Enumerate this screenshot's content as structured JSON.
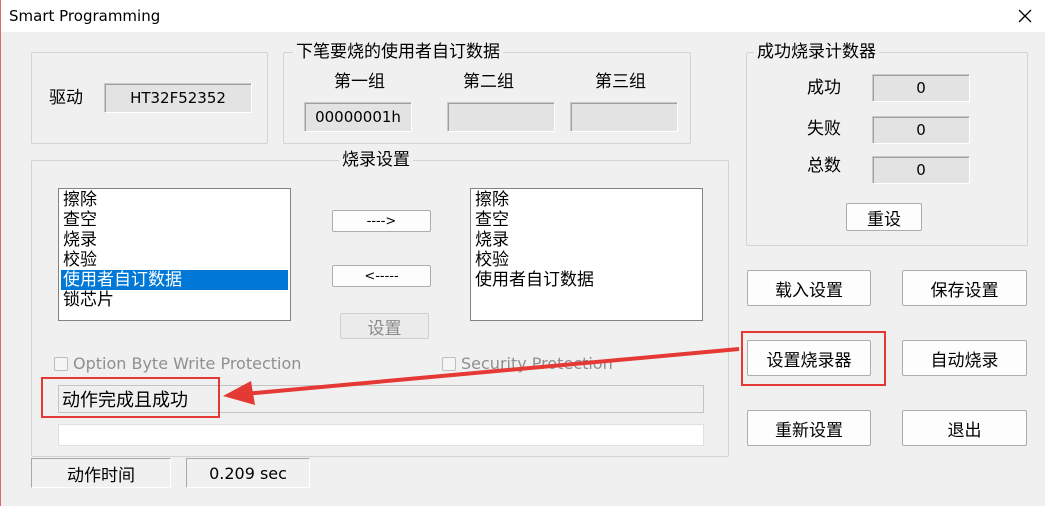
{
  "window": {
    "title": "Smart Programming"
  },
  "driver": {
    "label": "驱动",
    "value": "HT32F52352"
  },
  "user_data": {
    "legend": "下笔要烧的使用者自订数据",
    "groups": [
      {
        "label": "第一组",
        "value": "00000001h"
      },
      {
        "label": "第二组",
        "value": ""
      },
      {
        "label": "第三组",
        "value": ""
      }
    ]
  },
  "counter": {
    "legend": "成功烧录计数器",
    "success_label": "成功",
    "success_value": "0",
    "fail_label": "失败",
    "fail_value": "0",
    "total_label": "总数",
    "total_value": "0",
    "reset_label": "重设"
  },
  "burn_settings": {
    "legend": "烧录设置",
    "available_items": [
      "擦除",
      "查空",
      "烧录",
      "校验",
      "使用者自订数据",
      "锁芯片"
    ],
    "selected_index": 4,
    "chosen_items": [
      "擦除",
      "查空",
      "烧录",
      "校验",
      "使用者自订数据"
    ],
    "add_label": "---->",
    "remove_label": "<-----",
    "set_label": "设置",
    "option_byte_label": "Option Byte Write Protection",
    "security_label": "Security Protection"
  },
  "status": {
    "message": "动作完成且成功",
    "time_label": "动作时间",
    "time_value": "0.209 sec"
  },
  "buttons": {
    "load": "载入设置",
    "save": "保存设置",
    "setup_programmer": "设置烧录器",
    "auto_burn": "自动烧录",
    "reset_settings": "重新设置",
    "exit": "退出"
  },
  "colors": {
    "selection": "#0078d7",
    "annotation": "#e53935"
  }
}
